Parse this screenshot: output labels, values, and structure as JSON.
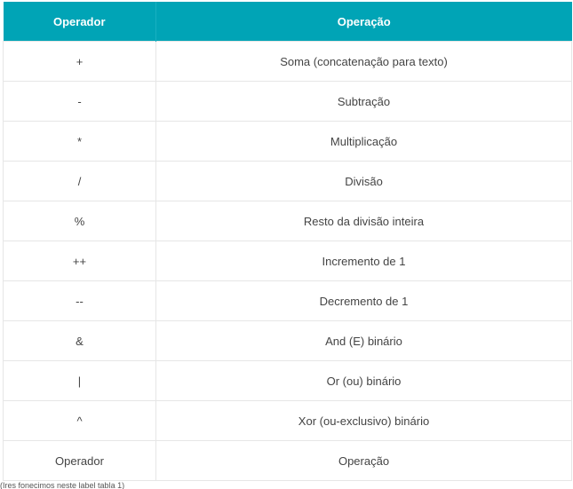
{
  "colors": {
    "header_bg": "#00a4b6",
    "header_text": "#ffffff",
    "cell_text": "#444444",
    "border": "#e6e6e6"
  },
  "table": {
    "headers": [
      "Operador",
      "Operação"
    ],
    "rows": [
      [
        "+",
        "Soma (concatenação para texto)"
      ],
      [
        "-",
        "Subtração"
      ],
      [
        "*",
        "Multiplicação"
      ],
      [
        "/",
        "Divisão"
      ],
      [
        "%",
        "Resto da divisão inteira"
      ],
      [
        "++",
        "Incremento de 1"
      ],
      [
        "--",
        "Decremento de 1"
      ],
      [
        "&",
        "And (E) binário"
      ],
      [
        "|",
        "Or (ou) binário"
      ],
      [
        "^",
        "Xor (ou-exclusivo) binário"
      ],
      [
        "Operador",
        "Operação"
      ]
    ]
  },
  "caption": "(Ires fonecimos neste label tabla 1)"
}
